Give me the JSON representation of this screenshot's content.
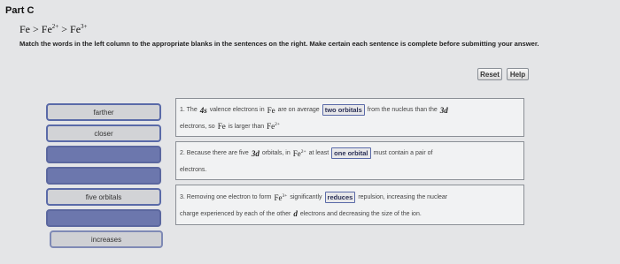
{
  "part": {
    "title": "Part C"
  },
  "formula": {
    "a": "Fe",
    "op1": ">",
    "b": "Fe",
    "b_charge": "2+",
    "op2": ">",
    "c": "Fe",
    "c_charge": "3+"
  },
  "instructions": "Match the words in the left column to the appropriate blanks in the sentences on the right. Make certain each sentence is complete before submitting your answer.",
  "toolbar": {
    "reset_label": "Reset",
    "help_label": "Help"
  },
  "word_bank": [
    {
      "label": "farther",
      "state": "filled"
    },
    {
      "label": "closer",
      "state": "filled"
    },
    {
      "label": "",
      "state": "empty"
    },
    {
      "label": "",
      "state": "empty"
    },
    {
      "label": "five orbitals",
      "state": "filled"
    },
    {
      "label": "",
      "state": "empty"
    },
    {
      "label": "increases",
      "state": "pale"
    }
  ],
  "sentences": [
    {
      "line1": {
        "p1": "1. The",
        "v1": "4s",
        "p2": "valence electrons in",
        "v2": "Fe",
        "p3": "are on average",
        "blank": "two orbitals",
        "p4": "from the nucleus than the",
        "v3": "3d"
      },
      "line2": {
        "p1": "electrons, so",
        "v1": "Fe",
        "p2": "is larger than",
        "v2": "Fe",
        "v2_charge": "2+"
      }
    },
    {
      "line1": {
        "p1": "2. Because there are five",
        "v1": "3d",
        "p2": "orbitals, in",
        "v2": "Fe",
        "v2_charge": "2+",
        "p3": "at least",
        "blank": "one orbital",
        "p4": "must contain a pair of"
      },
      "line2": {
        "p1": "electrons."
      }
    },
    {
      "line1": {
        "p1": "3. Removing one electron to form",
        "v1": "Fe",
        "v1_charge": "3+",
        "p2": "significantly",
        "blank": "reduces",
        "p3": "repulsion, increasing the nuclear"
      },
      "line2": {
        "p1": "charge experienced by each of the other",
        "v1": "d",
        "p2": "electrons and decreasing the size of the ion."
      }
    }
  ],
  "colors": {
    "accent_border": "#5a6aa8",
    "empty_chip": "#6c77ad"
  }
}
